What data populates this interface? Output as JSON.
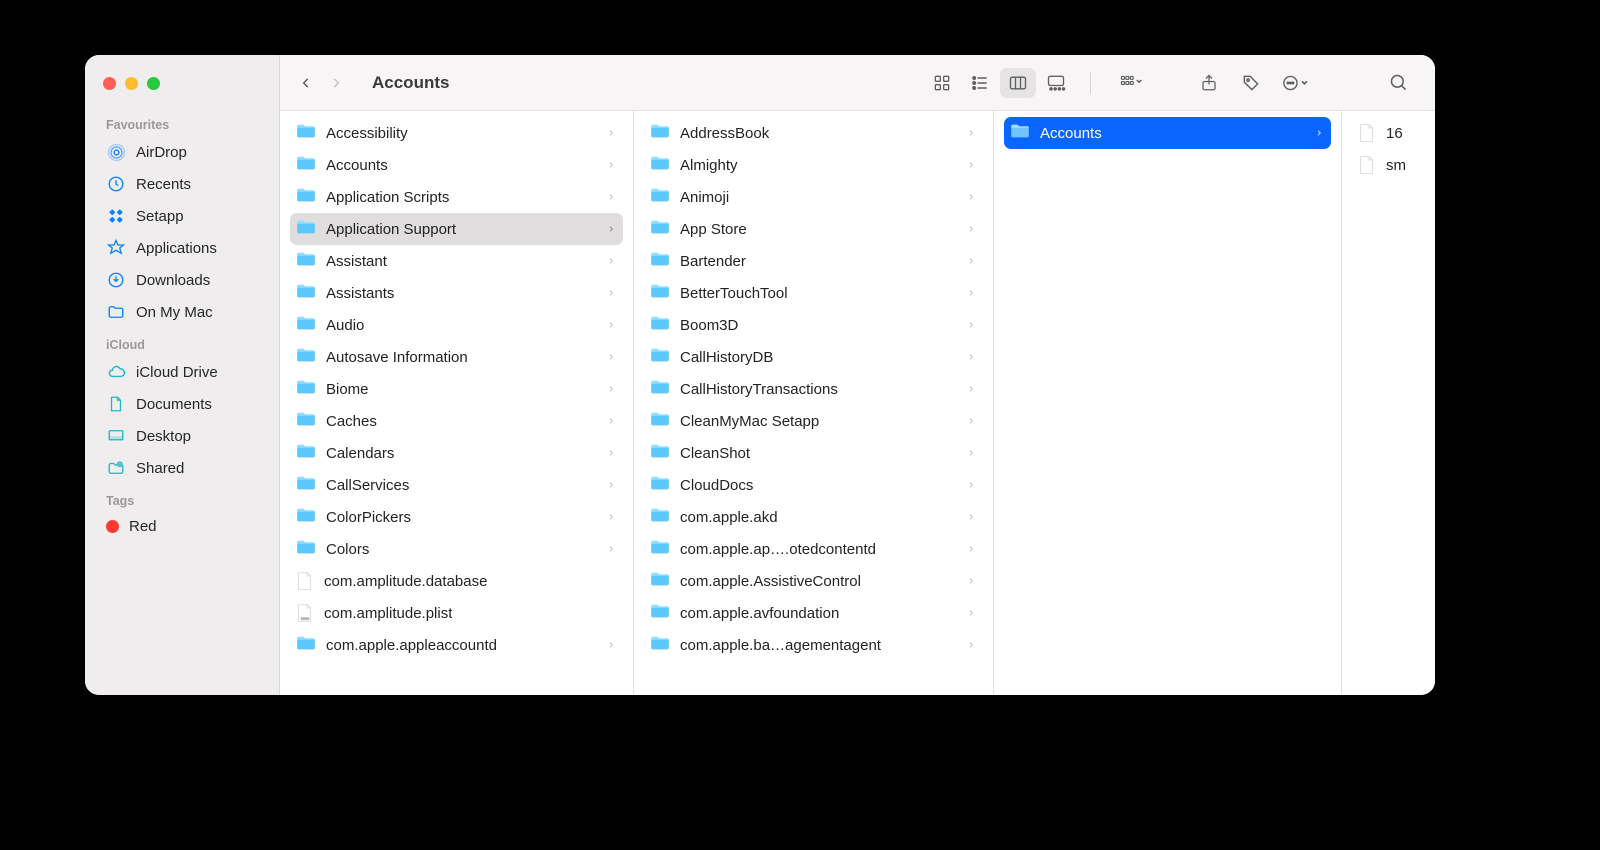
{
  "window_title": "Accounts",
  "sidebar": {
    "sections": [
      {
        "label": "Favourites",
        "items": [
          {
            "icon": "airdrop",
            "label": "AirDrop"
          },
          {
            "icon": "clock",
            "label": "Recents"
          },
          {
            "icon": "setapp",
            "label": "Setapp"
          },
          {
            "icon": "apps",
            "label": "Applications"
          },
          {
            "icon": "download",
            "label": "Downloads"
          },
          {
            "icon": "folder",
            "label": "On My Mac"
          }
        ]
      },
      {
        "label": "iCloud",
        "items": [
          {
            "icon": "cloud",
            "label": "iCloud Drive"
          },
          {
            "icon": "doc",
            "label": "Documents"
          },
          {
            "icon": "desktop",
            "label": "Desktop"
          },
          {
            "icon": "shared",
            "label": "Shared"
          }
        ]
      },
      {
        "label": "Tags",
        "items": [
          {
            "icon": "tag-red",
            "label": "Red"
          }
        ]
      }
    ]
  },
  "columns": [
    {
      "selected_index": 3,
      "items": [
        {
          "type": "folder",
          "label": "Accessibility",
          "arrow": true
        },
        {
          "type": "folder",
          "label": "Accounts",
          "arrow": true
        },
        {
          "type": "folder",
          "label": "Application Scripts",
          "arrow": true
        },
        {
          "type": "folder",
          "label": "Application Support",
          "arrow": true
        },
        {
          "type": "folder",
          "label": "Assistant",
          "arrow": true
        },
        {
          "type": "folder",
          "label": "Assistants",
          "arrow": true
        },
        {
          "type": "folder",
          "label": "Audio",
          "arrow": true
        },
        {
          "type": "folder",
          "label": "Autosave Information",
          "arrow": true
        },
        {
          "type": "folder",
          "label": "Biome",
          "arrow": true
        },
        {
          "type": "folder",
          "label": "Caches",
          "arrow": true
        },
        {
          "type": "folder",
          "label": "Calendars",
          "arrow": true
        },
        {
          "type": "folder",
          "label": "CallServices",
          "arrow": true
        },
        {
          "type": "folder",
          "label": "ColorPickers",
          "arrow": true
        },
        {
          "type": "folder",
          "label": "Colors",
          "arrow": true
        },
        {
          "type": "file-db",
          "label": "com.amplitude.database",
          "arrow": false
        },
        {
          "type": "file-plist",
          "label": "com.amplitude.plist",
          "arrow": false
        },
        {
          "type": "folder",
          "label": "com.apple.appleaccountd",
          "arrow": true
        }
      ]
    },
    {
      "selected_index": null,
      "items": [
        {
          "type": "folder",
          "label": "AddressBook",
          "arrow": true
        },
        {
          "type": "folder",
          "label": "Almighty",
          "arrow": true
        },
        {
          "type": "folder",
          "label": "Animoji",
          "arrow": true
        },
        {
          "type": "folder",
          "label": "App Store",
          "arrow": true
        },
        {
          "type": "folder",
          "label": "Bartender",
          "arrow": true
        },
        {
          "type": "folder",
          "label": "BetterTouchTool",
          "arrow": true
        },
        {
          "type": "folder",
          "label": "Boom3D",
          "arrow": true
        },
        {
          "type": "folder",
          "label": "CallHistoryDB",
          "arrow": true
        },
        {
          "type": "folder",
          "label": "CallHistoryTransactions",
          "arrow": true
        },
        {
          "type": "folder",
          "label": "CleanMyMac Setapp",
          "arrow": true
        },
        {
          "type": "folder",
          "label": "CleanShot",
          "arrow": true
        },
        {
          "type": "folder",
          "label": "CloudDocs",
          "arrow": true
        },
        {
          "type": "folder",
          "label": "com.apple.akd",
          "arrow": true
        },
        {
          "type": "folder",
          "label": "com.apple.ap….otedcontentd",
          "arrow": true
        },
        {
          "type": "folder",
          "label": "com.apple.AssistiveControl",
          "arrow": true
        },
        {
          "type": "folder",
          "label": "com.apple.avfoundation",
          "arrow": true
        },
        {
          "type": "folder",
          "label": "com.apple.ba…agementagent",
          "arrow": true
        }
      ]
    },
    {
      "selected_index": 0,
      "items": [
        {
          "type": "folder",
          "label": "Accounts",
          "arrow": true
        }
      ]
    },
    {
      "selected_index": null,
      "items": [
        {
          "type": "file",
          "label": "16"
        },
        {
          "type": "file",
          "label": "sm"
        }
      ]
    }
  ]
}
